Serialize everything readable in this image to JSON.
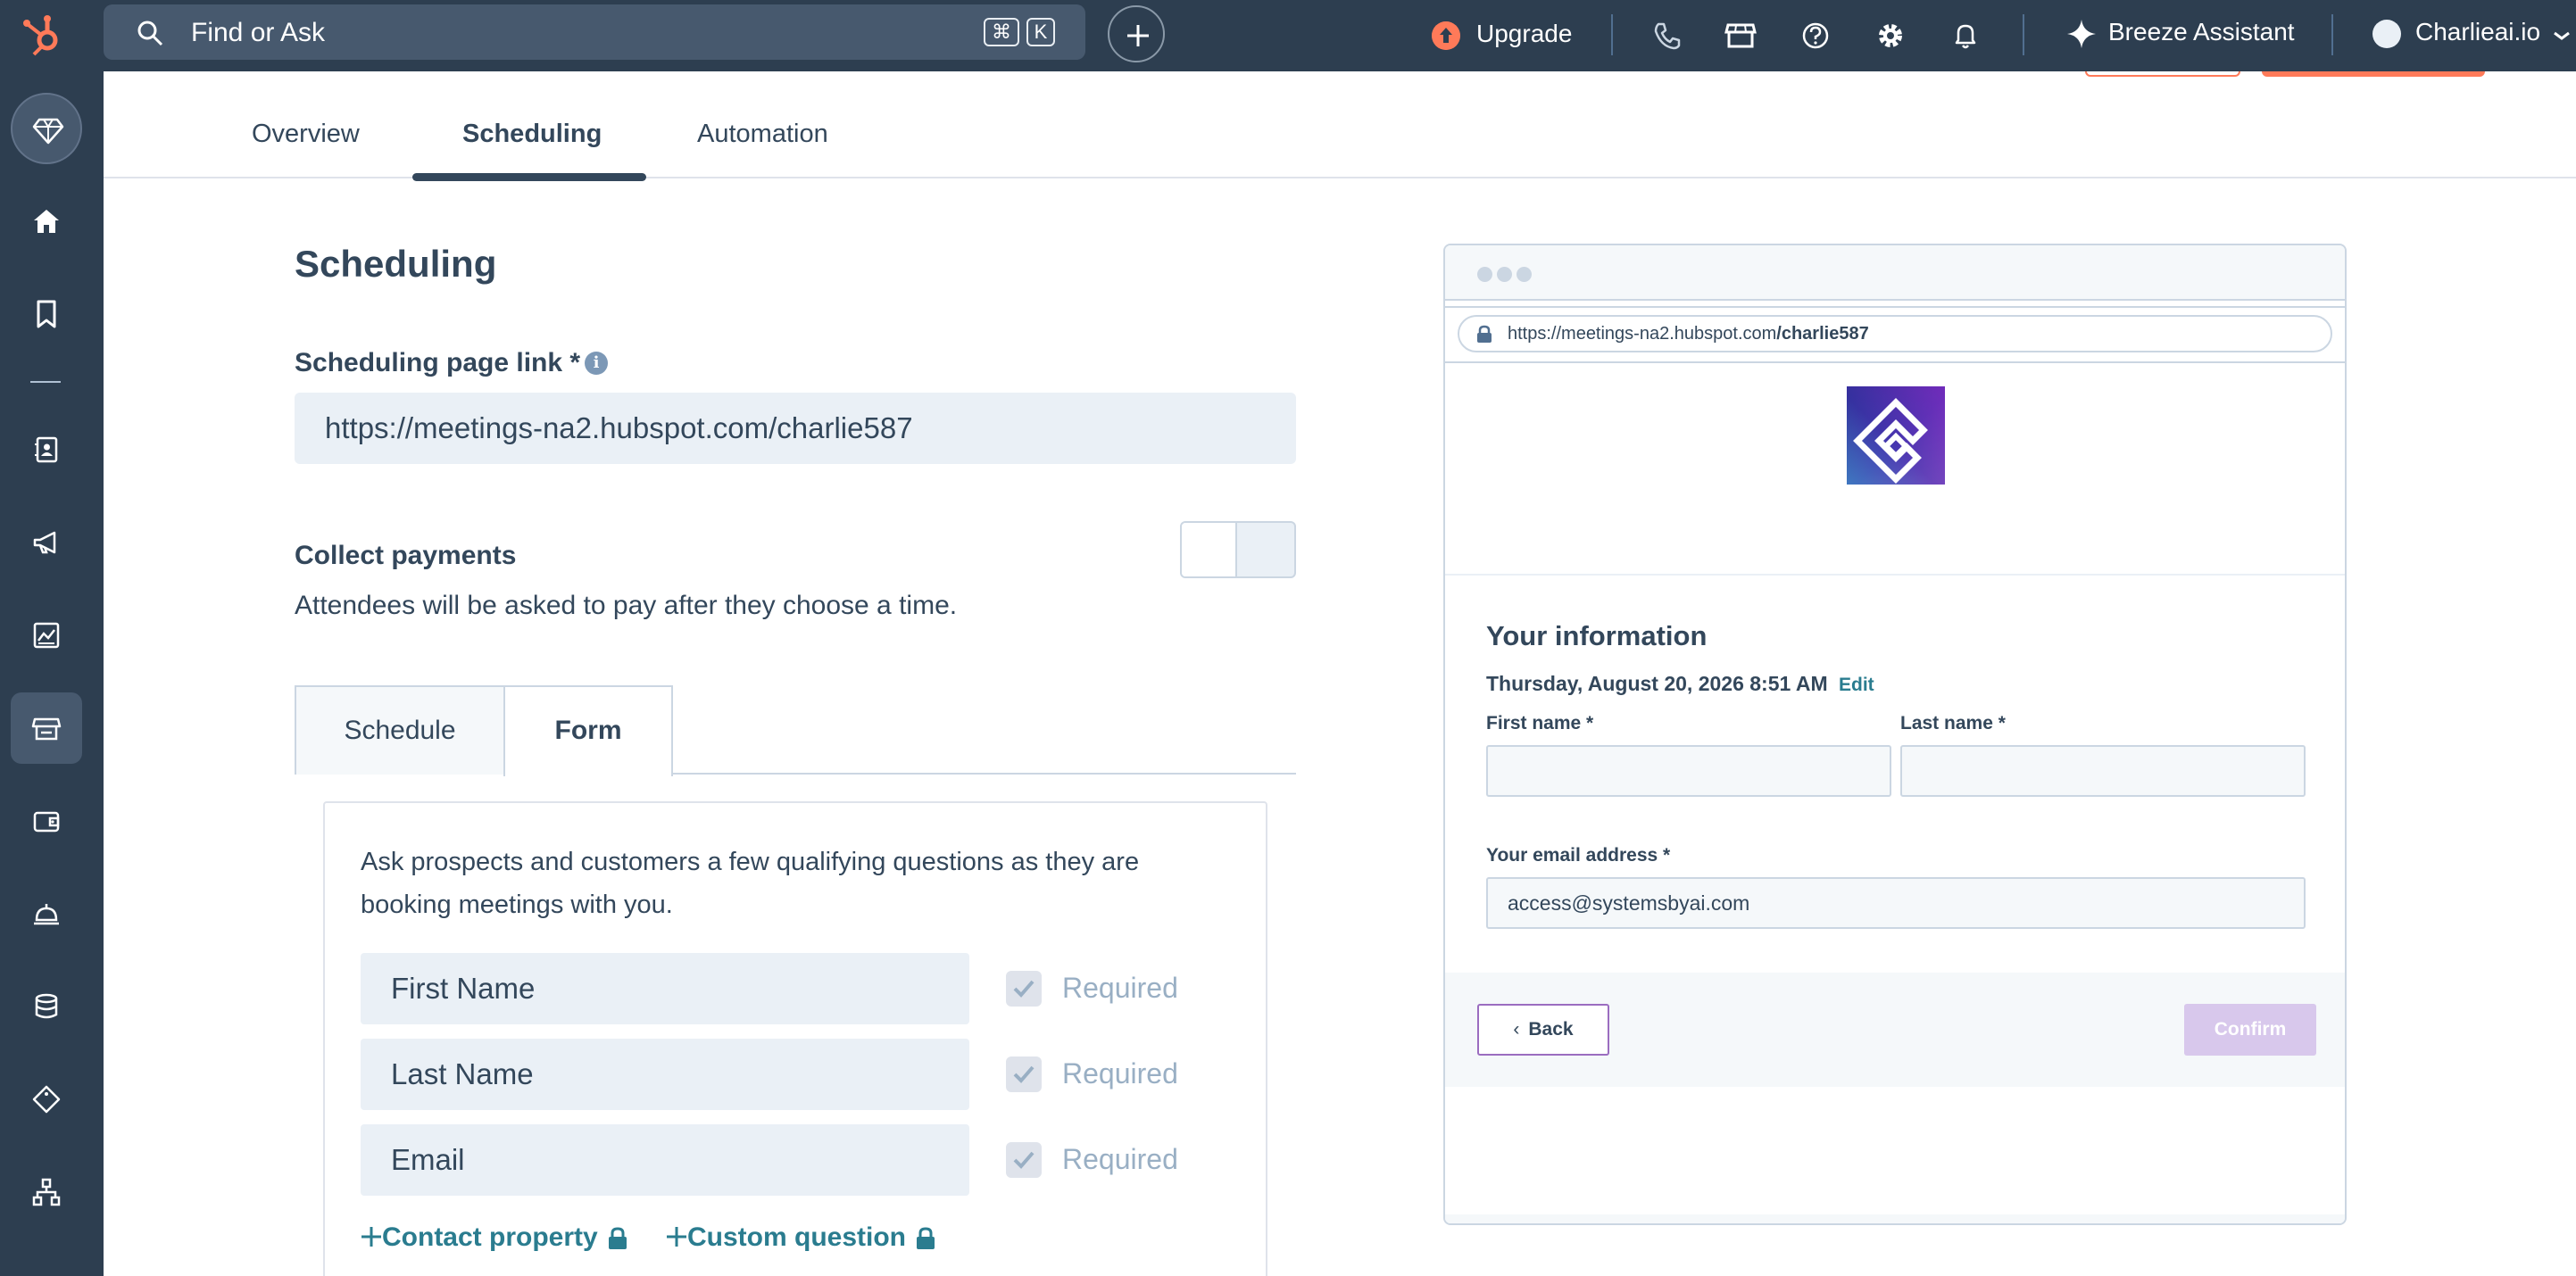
{
  "topbar": {
    "search_placeholder": "Find or Ask",
    "shortcut_cmd": "⌘",
    "shortcut_key": "K",
    "upgrade_label": "Upgrade",
    "assistant_label": "Breeze Assistant",
    "account_label": "Charlieai.io"
  },
  "tabs": [
    {
      "label": "Overview"
    },
    {
      "label": "Scheduling"
    },
    {
      "label": "Automation"
    }
  ],
  "scheduling": {
    "title": "Scheduling",
    "link_label": "Scheduling page link *",
    "link_value": "https://meetings-na2.hubspot.com/charlie587",
    "payments_title": "Collect payments",
    "payments_desc": "Attendees will be asked to pay after they choose a time.",
    "payments_enabled": false
  },
  "subtabs": [
    {
      "label": "Schedule"
    },
    {
      "label": "Form"
    }
  ],
  "form": {
    "description": "Ask prospects and customers a few qualifying questions as they are booking meetings with you.",
    "fields": [
      {
        "label": "First Name",
        "required_label": "Required",
        "required": true
      },
      {
        "label": "Last Name",
        "required_label": "Required",
        "required": true
      },
      {
        "label": "Email",
        "required_label": "Required",
        "required": true
      }
    ],
    "add_contact_property": "Contact property",
    "add_custom_question": "Custom question"
  },
  "preview": {
    "url_prefix": "https://meetings-na2.hubspot.com",
    "url_path": "/charlie587",
    "title": "Your information",
    "datetime": "Thursday, August 20, 2026 8:51 AM",
    "edit_label": "Edit",
    "first_name_label": "First name *",
    "last_name_label": "Last name *",
    "email_label": "Your email address *",
    "email_value": "access@systemsbyai.com",
    "back_label": "Back",
    "confirm_label": "Confirm"
  },
  "colors": {
    "nav_bg": "#2d3e50",
    "accent_orange": "#ff7a59",
    "link_teal": "#2a7c8f",
    "text_dark": "#33475b"
  }
}
